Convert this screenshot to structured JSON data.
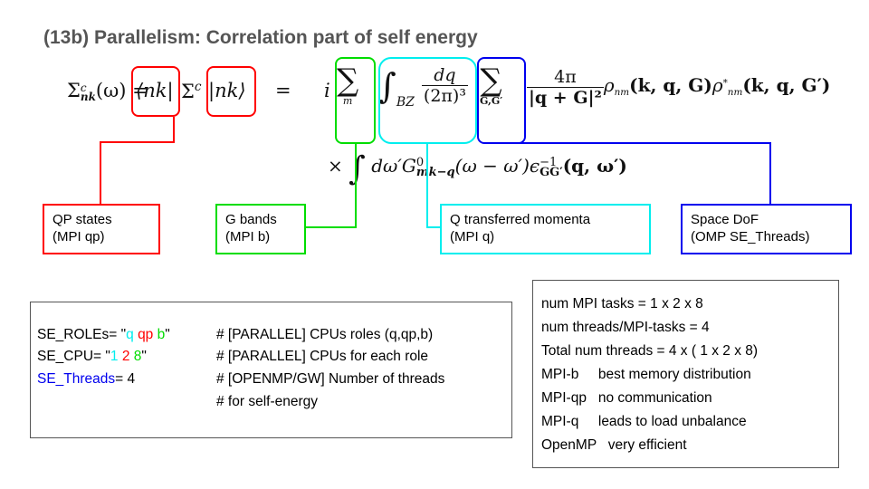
{
  "title": "(13b) Parallelism: Correlation part of self energy",
  "formula": {
    "lhs": "Σ",
    "lhs_sup": "c",
    "lhs_sub": "nk",
    "lhs_arg": "(ω) =",
    "bra": "⟨nk|",
    "op": "Σ",
    "op_sup": "c",
    "ket": "|nk⟩",
    "eq": "=",
    "i": "i",
    "sum_m": "∑",
    "sum_m_lim": "m",
    "int": "∫",
    "int_lim": "BZ",
    "dq_num": "dq",
    "dq_den": "(2π)³",
    "sum_G": "∑",
    "sum_G_lim": "G,G′",
    "coul_num": "4π",
    "coul_den": "|q + G|²",
    "rho": "ρ",
    "rho_sub": "nm",
    "rho_arg": "(k, q, G)",
    "rho2": "ρ",
    "rho2_sup": "*",
    "rho2_sub": "nm",
    "rho2_arg": "(k, q, G′)",
    "line2_times": "×",
    "line2_int": "∫",
    "line2_body": "dω′G",
    "line2_G_sup": "0",
    "line2_G_sub": "mk−q",
    "line2_arg": "(ω − ω′)ϵ",
    "line2_eps_sup": "−1",
    "line2_eps_sub": "GG′",
    "line2_eps_arg": "(q, ω′)"
  },
  "labels": {
    "qp": {
      "line1": "QP states",
      "line2": "(MPI qp)",
      "color": "#ff0000"
    },
    "bands": {
      "line1": "G bands",
      "line2": "(MPI b)",
      "color": "#00dd00"
    },
    "q": {
      "line1": "Q transferred momenta",
      "line2": "(MPI q)",
      "color": "#00eeee"
    },
    "space": {
      "line1": "Space DoF",
      "line2": "(OMP SE_Threads)",
      "color": "#0000ee"
    }
  },
  "code": {
    "roles_key": "SE_ROLEs= \"",
    "roles_q": "q",
    "roles_qp": "qp",
    "roles_b": "b",
    "roles_end": "\"",
    "roles_comment": "# [PARALLEL] CPUs roles (q,qp,b)",
    "cpu_key": "SE_CPU= \"",
    "cpu_1": "1",
    "cpu_2": "2",
    "cpu_8": "8",
    "cpu_end": "\"",
    "cpu_comment": "# [PARALLEL] CPUs for each role",
    "threads_key": "SE_Threads",
    "threads_val": "= 4",
    "threads_comment": "# [OPENMP/GW] Number of threads",
    "threads_comment2": "# for  self-energy"
  },
  "summary": [
    "num MPI tasks = 1 x 2 x 8",
    "num threads/MPI-tasks = 4",
    "Total num threads = 4 x ( 1 x 2 x 8)",
    "MPI-b     best memory distribution",
    "MPI-qp   no communication",
    "MPI-q     leads to load unbalance",
    "OpenMP   very efficient"
  ],
  "colors": {
    "red": "#ff0000",
    "green": "#00dd00",
    "cyan": "#00eeee",
    "blue": "#0000ee",
    "title": "#555555"
  }
}
